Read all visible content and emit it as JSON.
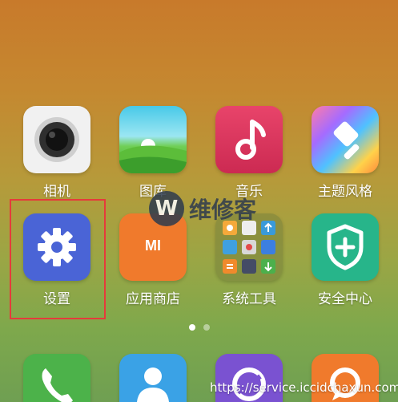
{
  "apps": [
    {
      "label": "相机",
      "icon": "camera-icon"
    },
    {
      "label": "图库",
      "icon": "gallery-icon"
    },
    {
      "label": "音乐",
      "icon": "music-icon"
    },
    {
      "label": "主题风格",
      "icon": "theme-icon"
    },
    {
      "label": "设置",
      "icon": "gear-icon"
    },
    {
      "label": "应用商店",
      "icon": "mi-store-icon",
      "badge_text": "MI"
    },
    {
      "label": "系统工具",
      "icon": "folder-icon"
    },
    {
      "label": "安全中心",
      "icon": "shield-plus-icon"
    }
  ],
  "dock": [
    {
      "icon": "phone-icon"
    },
    {
      "icon": "contacts-icon"
    },
    {
      "icon": "browser-icon"
    },
    {
      "icon": "messages-icon"
    }
  ],
  "watermark": {
    "badge": "W",
    "text": "维修客"
  },
  "page_indicator": {
    "pages": 2,
    "current": 1
  },
  "url_text": "https://service.iccidchaxun.com",
  "colors": {
    "settings": "#4a64d6",
    "store": "#f07a2c",
    "security": "#27b58a",
    "music": "#e23a63",
    "highlight": "#e53b3b"
  }
}
